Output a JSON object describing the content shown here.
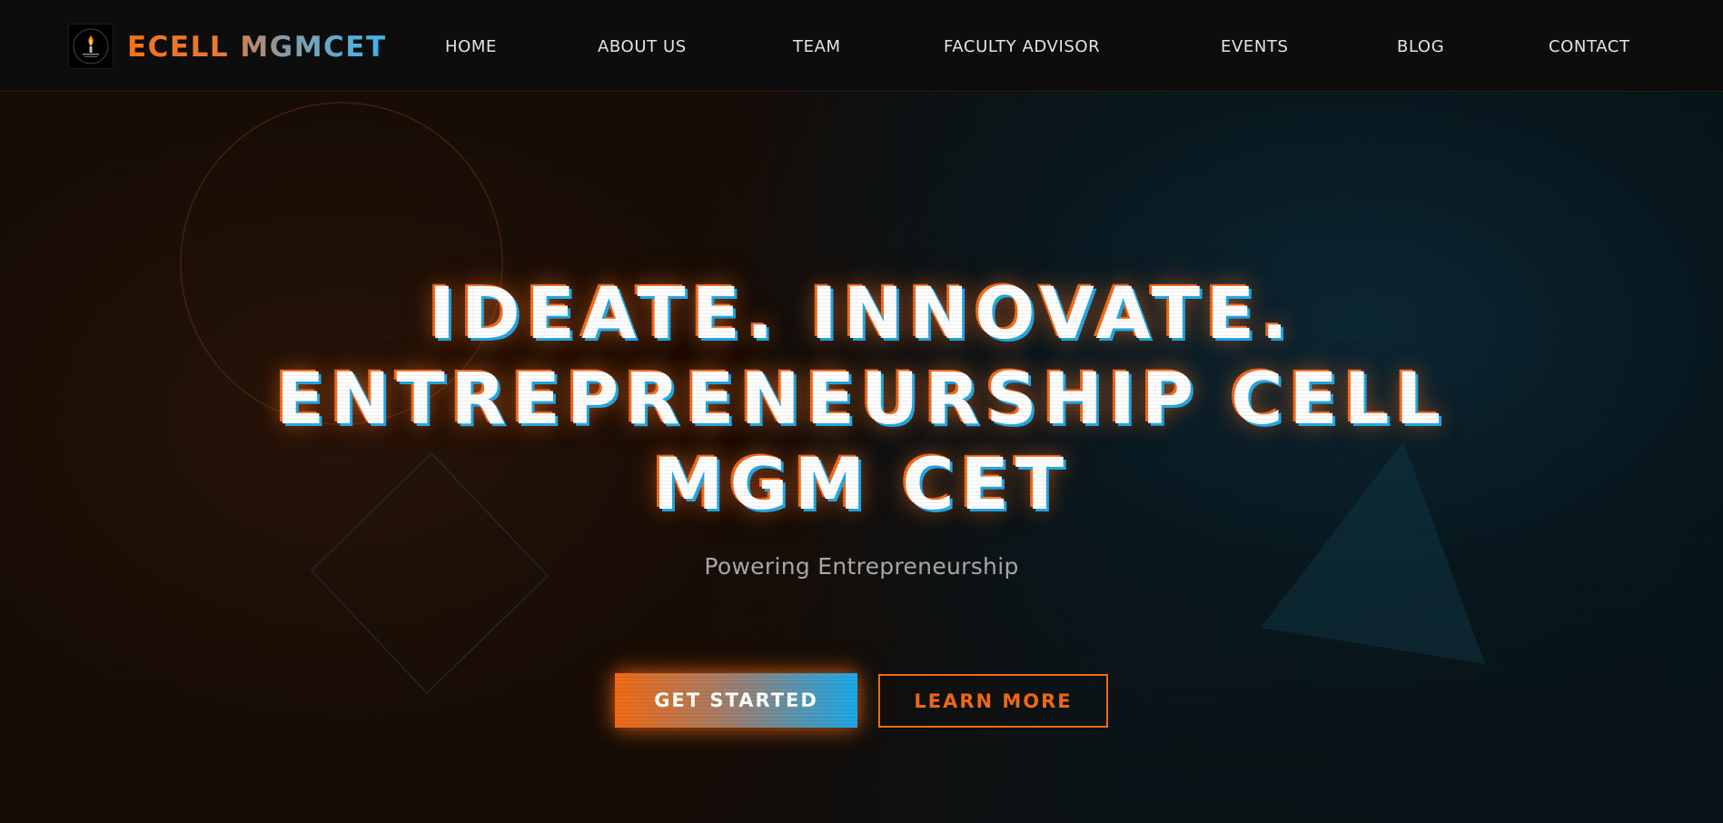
{
  "navbar": {
    "logo_icon": "ecell-torch-logo-icon",
    "brand": "ECELL MGMCET",
    "links": [
      {
        "label": "HOME"
      },
      {
        "label": "ABOUT US"
      },
      {
        "label": "TEAM"
      },
      {
        "label": "FACULTY ADVISOR"
      },
      {
        "label": "EVENTS"
      },
      {
        "label": "BLOG"
      },
      {
        "label": "CONTACT"
      }
    ]
  },
  "hero": {
    "headline_lines": [
      "IDEATE. INNOVATE.",
      "ENTREPRENEURSHIP CELL",
      "MGM CET"
    ],
    "tagline": "Powering Entrepreneurship",
    "primary_button": "GET STARTED",
    "secondary_button": "LEARN MORE"
  },
  "colors": {
    "accent_orange": "#f26a14",
    "accent_blue": "#1aa9ea",
    "background": "#0d0d0d"
  }
}
